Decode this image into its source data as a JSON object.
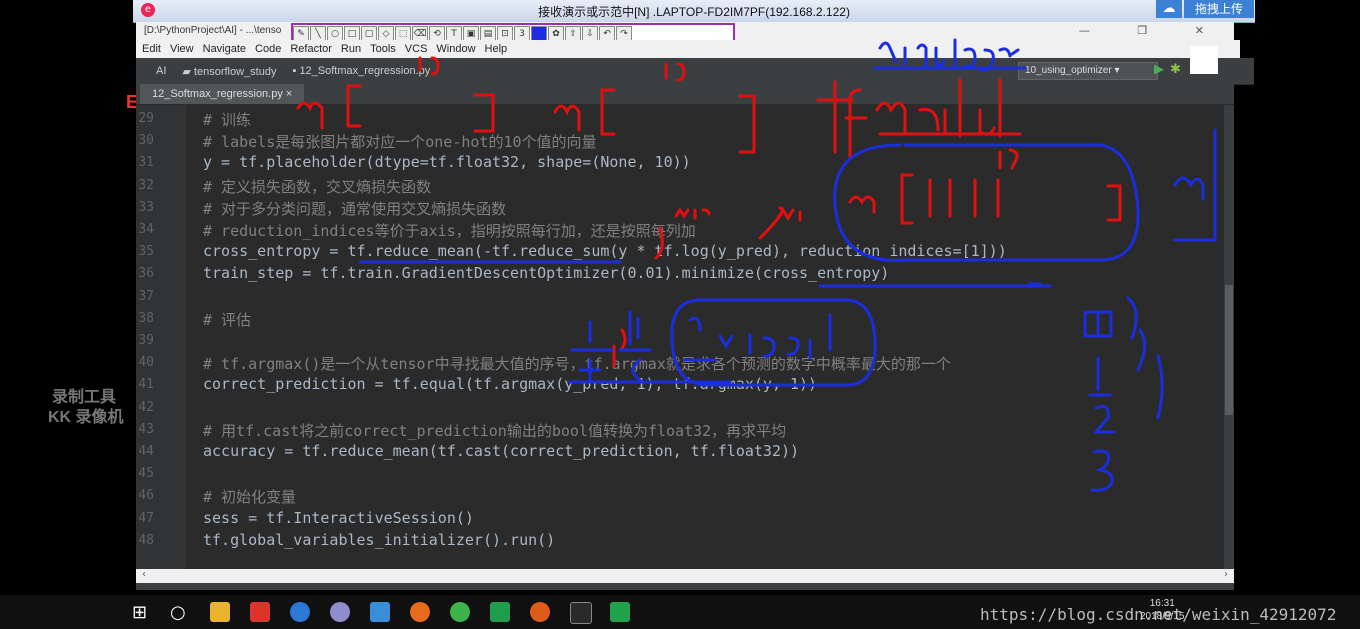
{
  "remote_bar": {
    "title": "接收演示或示范中[N] .LAPTOP-FD2IM7PF(192.168.2.122)",
    "upload_label": "拖拽上传"
  },
  "path_bar": {
    "path": "[D:\\PythonProject\\AI] - ...\\tenso"
  },
  "window_controls": {
    "label": "— ❐ ✕"
  },
  "annotation_toolbar": {
    "width_value": "3"
  },
  "menu": {
    "items": [
      "Edit",
      "View",
      "Navigate",
      "Code",
      "Refactor",
      "Run",
      "Tools",
      "VCS",
      "Window",
      "Help"
    ]
  },
  "breadcrumb": {
    "root": "AI",
    "folder": "tensorflow_study",
    "file": "12_Softmax_regression.py"
  },
  "run_config": {
    "label": "10_using_optimizer ▾"
  },
  "tab": {
    "label": "12_Softmax_regression.py ×"
  },
  "code_lines": [
    {
      "num": "29",
      "text": "# 训练",
      "kind": "comment"
    },
    {
      "num": "30",
      "text": "# labels是每张图片都对应一个one-hot的10个值的向量",
      "kind": "comment"
    },
    {
      "num": "31",
      "text": "y = tf.placeholder(dtype=tf.float32, shape=(None, 10))",
      "kind": "code"
    },
    {
      "num": "32",
      "text": "# 定义损失函数，交叉熵损失函数",
      "kind": "comment"
    },
    {
      "num": "33",
      "text": "# 对于多分类问题，通常使用交叉熵损失函数",
      "kind": "comment"
    },
    {
      "num": "34",
      "text": "# reduction_indices等价于axis，指明按照每行加，还是按照每列加",
      "kind": "comment"
    },
    {
      "num": "35",
      "text": "cross_entropy = tf.reduce_mean(-tf.reduce_sum(y * tf.log(y_pred), reduction_indices=[1]))",
      "kind": "code"
    },
    {
      "num": "36",
      "text": "train_step = tf.train.GradientDescentOptimizer(0.01).minimize(cross_entropy)",
      "kind": "code"
    },
    {
      "num": "37",
      "text": "",
      "kind": "code"
    },
    {
      "num": "38",
      "text": "# 评估",
      "kind": "comment"
    },
    {
      "num": "39",
      "text": "",
      "kind": "code"
    },
    {
      "num": "40",
      "text": "# tf.argmax()是一个从tensor中寻找最大值的序号，tf.argmax就是求各个预测的数字中概率最大的那一个",
      "kind": "comment"
    },
    {
      "num": "41",
      "text": "correct_prediction = tf.equal(tf.argmax(y_pred, 1), tf.argmax(y, 1))",
      "kind": "code"
    },
    {
      "num": "42",
      "text": "",
      "kind": "code"
    },
    {
      "num": "43",
      "text": "# 用tf.cast将之前correct_prediction输出的bool值转换为float32，再求平均",
      "kind": "comment"
    },
    {
      "num": "44",
      "text": "accuracy = tf.reduce_mean(tf.cast(correct_prediction, tf.float32))",
      "kind": "code"
    },
    {
      "num": "45",
      "text": "",
      "kind": "code"
    },
    {
      "num": "46",
      "text": "# 初始化变量",
      "kind": "comment"
    },
    {
      "num": "47",
      "text": "sess = tf.InteractiveSession()",
      "kind": "code"
    },
    {
      "num": "48",
      "text": "tf.global_variables_initializer().run()",
      "kind": "code"
    }
  ],
  "watermark": {
    "line1": "录制工具",
    "line2": "KK 录像机"
  },
  "taskbar": {
    "tray_text": "https://blog.csdn.net/weixin_42912072",
    "time": "16:31",
    "date": "2018/9/15"
  },
  "colors": {
    "ink_red": "#e01010",
    "ink_blue": "#1a2ee0",
    "editor_bg": "#2b2b2b",
    "comment": "#808080",
    "keyword_param": "#aa4926"
  }
}
